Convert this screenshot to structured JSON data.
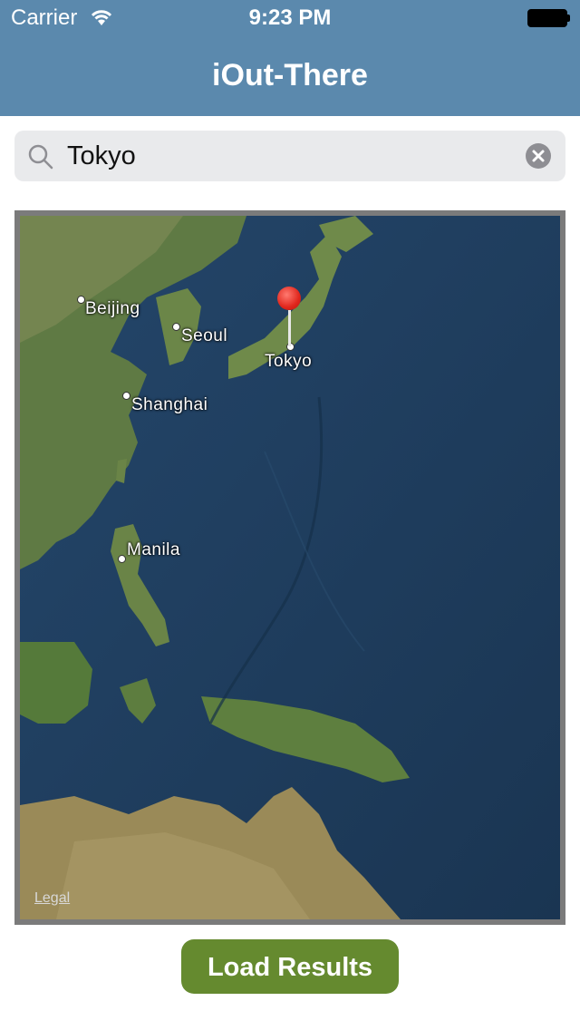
{
  "status_bar": {
    "carrier": "Carrier",
    "time": "9:23 PM"
  },
  "nav": {
    "title": "iOut-There"
  },
  "search": {
    "value": "Tokyo"
  },
  "map": {
    "cities": [
      {
        "label": "Beijing"
      },
      {
        "label": "Seoul"
      },
      {
        "label": "Tokyo"
      },
      {
        "label": "Shanghai"
      },
      {
        "label": "Manila"
      }
    ],
    "legal_label": "Legal",
    "pin_color": "#e0261c"
  },
  "actions": {
    "load_label": "Load Results"
  },
  "colors": {
    "nav_bar": "#5b89ad",
    "button": "#658a2f",
    "search_bg": "#e9eaec"
  }
}
